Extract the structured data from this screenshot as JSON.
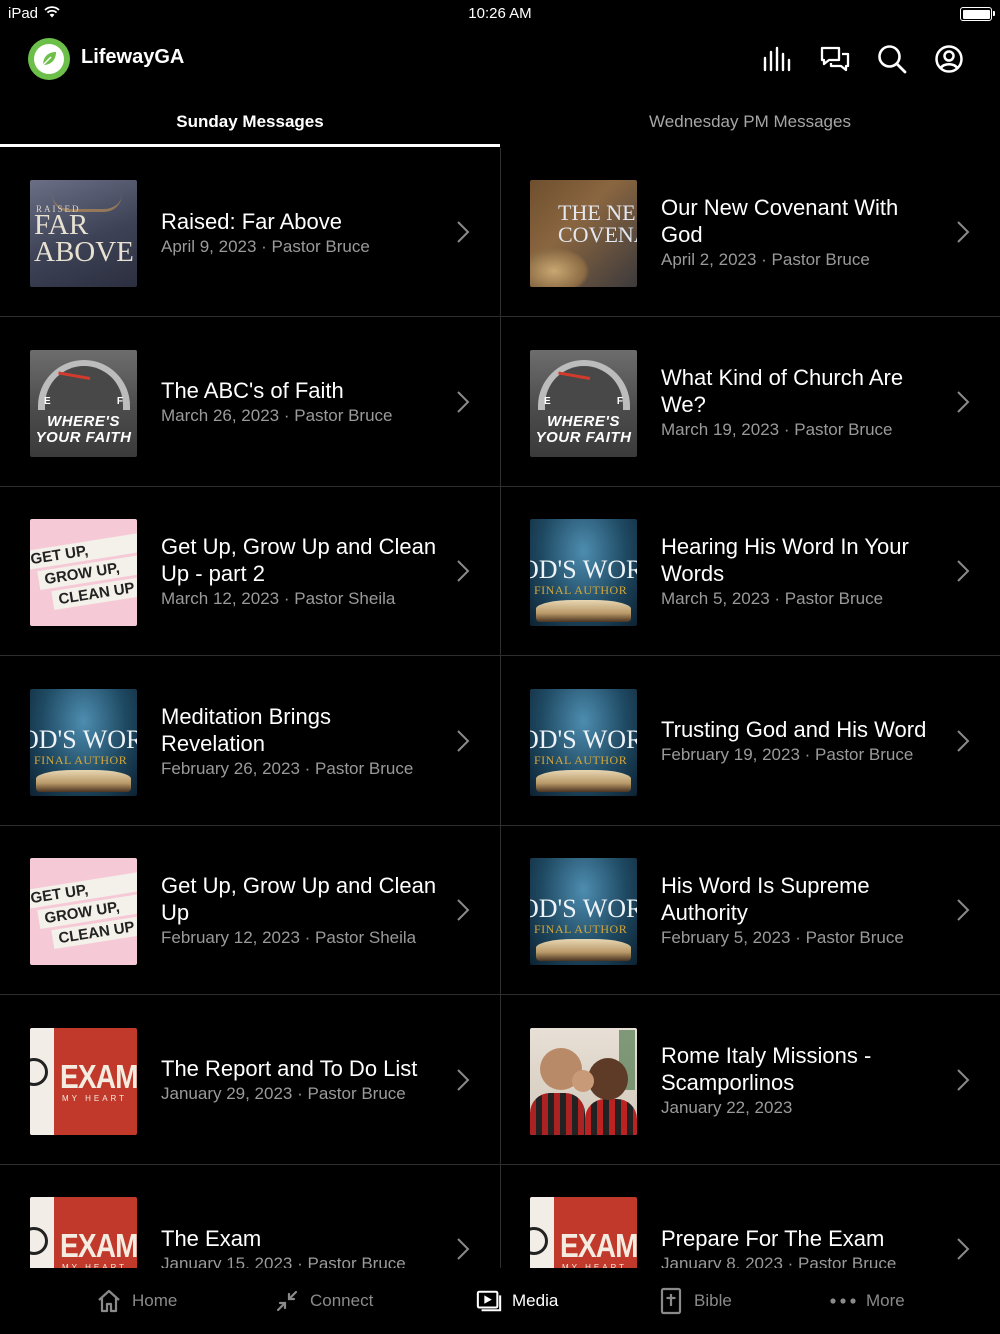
{
  "status_bar": {
    "device": "iPad",
    "time": "10:26 AM"
  },
  "header": {
    "app_title": "LifewayGA",
    "icons": [
      "equalizer-icon",
      "chat-icon",
      "search-icon",
      "account-icon"
    ]
  },
  "tabs": [
    {
      "label": "Sunday Messages",
      "active": true
    },
    {
      "label": "Wednesday PM Messages",
      "active": false
    }
  ],
  "sermons": [
    {
      "title": "Raised: Far Above",
      "subtitle": "April 9, 2023 · Pastor Bruce",
      "thumb": "far",
      "thumb_text": [
        "RAISED",
        "FAR ABOVE"
      ]
    },
    {
      "title": "Our New Covenant With God",
      "subtitle": "April 2, 2023 · Pastor Bruce",
      "thumb": "cov",
      "thumb_text": [
        "THE NE COVENA"
      ]
    },
    {
      "title": "The ABC's of Faith",
      "subtitle": "March 26, 2023 · Pastor Bruce",
      "thumb": "faith",
      "thumb_text": [
        "WHERE'S YOUR FAITH"
      ]
    },
    {
      "title": "What Kind of Church Are We?",
      "subtitle": "March 19, 2023 · Pastor Bruce",
      "thumb": "faith",
      "thumb_text": [
        "WHERE'S YOUR FAITH"
      ]
    },
    {
      "title": "Get Up, Grow Up and Clean Up  - part 2",
      "subtitle": "March 12, 2023 · Pastor Sheila",
      "thumb": "grow",
      "thumb_text": [
        "GET UP,",
        "GROW UP,",
        "CLEAN UP"
      ]
    },
    {
      "title": "Hearing His Word In Your Words",
      "subtitle": "March 5, 2023 · Pastor Bruce",
      "thumb": "word",
      "thumb_text": [
        "OD'S WOR",
        "FINAL AUTHOR"
      ]
    },
    {
      "title": "Meditation Brings Revelation",
      "subtitle": "February 26, 2023 · Pastor Bruce",
      "thumb": "word",
      "thumb_text": [
        "OD'S WOR",
        "FINAL AUTHOR"
      ]
    },
    {
      "title": "Trusting God and His Word",
      "subtitle": "February 19, 2023 · Pastor Bruce",
      "thumb": "word",
      "thumb_text": [
        "OD'S WOR",
        "FINAL AUTHOR"
      ]
    },
    {
      "title": "Get Up, Grow Up and Clean Up",
      "subtitle": "February 12, 2023 · Pastor Sheila",
      "thumb": "grow",
      "thumb_text": [
        "GET UP,",
        "GROW UP,",
        "CLEAN UP"
      ]
    },
    {
      "title": "His Word Is Supreme Authority",
      "subtitle": "February 5, 2023 · Pastor Bruce",
      "thumb": "word",
      "thumb_text": [
        "OD'S WOR",
        "FINAL AUTHOR"
      ]
    },
    {
      "title": "The Report and To Do List",
      "subtitle": "January 29, 2023 · Pastor Bruce",
      "thumb": "exam",
      "thumb_text": [
        "EXAMI",
        "MY HEART"
      ]
    },
    {
      "title": "Rome Italy Missions - Scamporlinos",
      "subtitle": "January 22, 2023",
      "thumb": "family",
      "thumb_text": []
    },
    {
      "title": "The Exam",
      "subtitle": "January 15, 2023 · Pastor Bruce",
      "thumb": "exam",
      "thumb_text": [
        "EXAMI",
        "MY HEART"
      ]
    },
    {
      "title": "Prepare For The Exam",
      "subtitle": "January 8, 2023 · Pastor Bruce",
      "thumb": "exam",
      "thumb_text": [
        "EXAMI",
        "MY HEART"
      ]
    }
  ],
  "bottom_nav": [
    {
      "label": "Home",
      "icon": "home-icon",
      "active": false
    },
    {
      "label": "Connect",
      "icon": "connect-icon",
      "active": false
    },
    {
      "label": "Media",
      "icon": "media-icon",
      "active": true
    },
    {
      "label": "Bible",
      "icon": "bible-icon",
      "active": false
    },
    {
      "label": "More",
      "icon": "more-icon",
      "active": false
    }
  ],
  "colors": {
    "background": "#000000",
    "brand_green": "#6cc04a",
    "secondary_text": "#9a9a9a",
    "divider": "#2e2e2e"
  }
}
